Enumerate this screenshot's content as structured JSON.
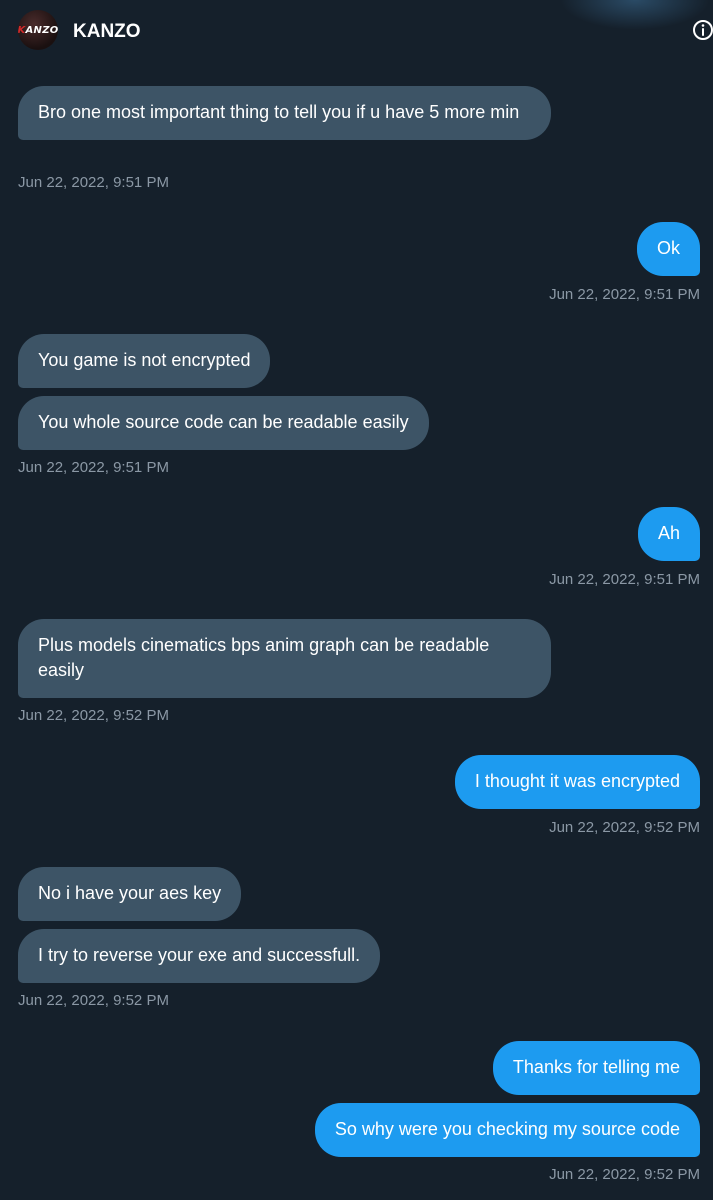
{
  "header": {
    "contact_name": "KANZO",
    "avatar_text": "KANZO",
    "info_icon": "info-icon"
  },
  "messages": [
    {
      "side": "received",
      "text": "Bro one most important thing to tell you if u have 5 more min"
    },
    {
      "side": "received",
      "timestamp": "Jun 22, 2022, 9:51 PM"
    },
    {
      "side": "sent",
      "text": "Ok"
    },
    {
      "side": "sent",
      "timestamp": "Jun 22, 2022, 9:51 PM"
    },
    {
      "side": "received",
      "text": "You game is not encrypted"
    },
    {
      "side": "received",
      "text": "You whole source code can be readable easily"
    },
    {
      "side": "received",
      "timestamp": "Jun 22, 2022, 9:51 PM"
    },
    {
      "side": "sent",
      "text": "Ah"
    },
    {
      "side": "sent",
      "timestamp": "Jun 22, 2022, 9:51 PM"
    },
    {
      "side": "received",
      "text": "Plus models cinematics bps anim graph can be readable easily"
    },
    {
      "side": "received",
      "timestamp": "Jun 22, 2022, 9:52 PM"
    },
    {
      "side": "sent",
      "text": "I thought it was encrypted"
    },
    {
      "side": "sent",
      "timestamp": "Jun 22, 2022, 9:52 PM"
    },
    {
      "side": "received",
      "text": "No i have your aes key"
    },
    {
      "side": "received",
      "text": "I try to reverse your exe and successfull."
    },
    {
      "side": "received",
      "timestamp": "Jun 22, 2022, 9:52 PM"
    },
    {
      "side": "sent",
      "text": "Thanks for telling me"
    },
    {
      "side": "sent",
      "text": "So why were you checking my source code"
    },
    {
      "side": "sent",
      "timestamp": "Jun 22, 2022, 9:52 PM"
    }
  ],
  "colors": {
    "background": "#15202b",
    "received_bubble": "#3d5466",
    "sent_bubble": "#1d9bf0",
    "timestamp": "#8b98a5"
  }
}
